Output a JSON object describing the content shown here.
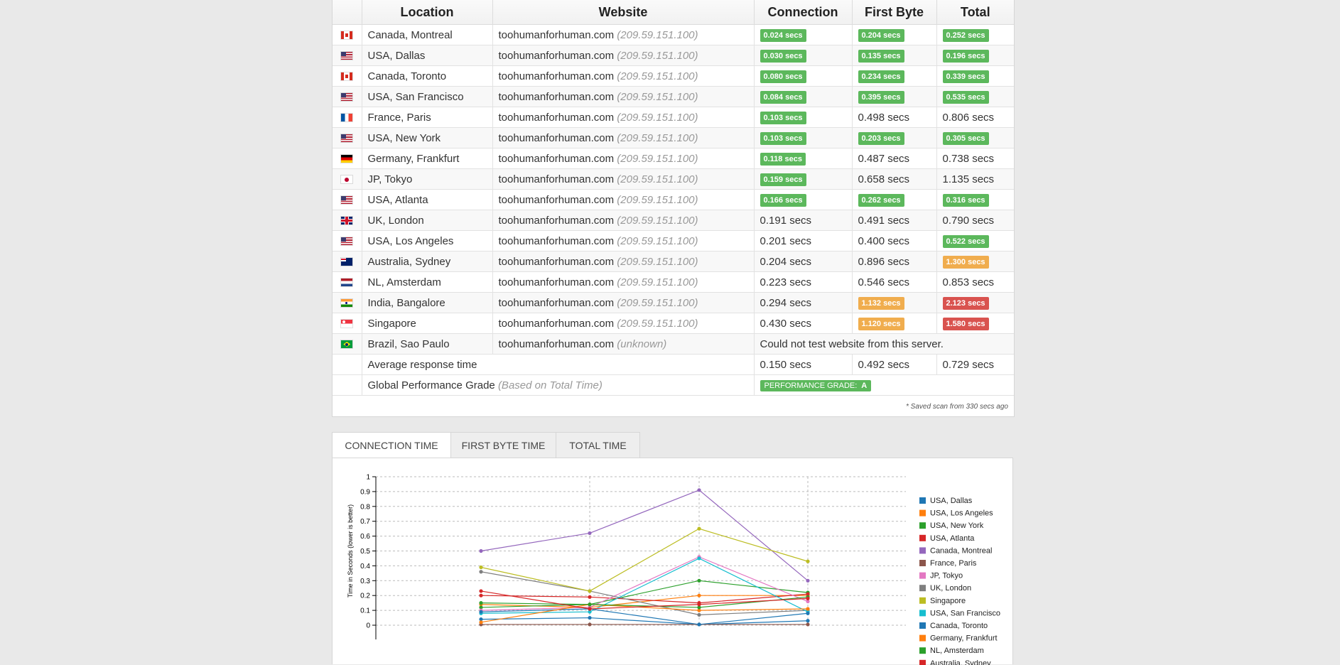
{
  "table": {
    "headers": {
      "location": "Location",
      "website": "Website",
      "connection": "Connection",
      "first_byte": "First Byte",
      "total": "Total"
    },
    "rows": [
      {
        "flag": "ca",
        "location": "Canada, Montreal",
        "site": "toohumanforhuman.com",
        "ip": "(209.59.151.100)",
        "conn": "0.024 secs",
        "conn_s": "green",
        "fb": "0.204 secs",
        "fb_s": "green",
        "total": "0.252 secs",
        "total_s": "green"
      },
      {
        "flag": "us",
        "location": "USA, Dallas",
        "site": "toohumanforhuman.com",
        "ip": "(209.59.151.100)",
        "conn": "0.030 secs",
        "conn_s": "green",
        "fb": "0.135 secs",
        "fb_s": "green",
        "total": "0.196 secs",
        "total_s": "green"
      },
      {
        "flag": "ca",
        "location": "Canada, Toronto",
        "site": "toohumanforhuman.com",
        "ip": "(209.59.151.100)",
        "conn": "0.080 secs",
        "conn_s": "green",
        "fb": "0.234 secs",
        "fb_s": "green",
        "total": "0.339 secs",
        "total_s": "green"
      },
      {
        "flag": "us",
        "location": "USA, San Francisco",
        "site": "toohumanforhuman.com",
        "ip": "(209.59.151.100)",
        "conn": "0.084 secs",
        "conn_s": "green",
        "fb": "0.395 secs",
        "fb_s": "green",
        "total": "0.535 secs",
        "total_s": "green"
      },
      {
        "flag": "fr",
        "location": "France, Paris",
        "site": "toohumanforhuman.com",
        "ip": "(209.59.151.100)",
        "conn": "0.103 secs",
        "conn_s": "green",
        "fb": "0.498 secs",
        "fb_s": "",
        "total": "0.806 secs",
        "total_s": ""
      },
      {
        "flag": "us",
        "location": "USA, New York",
        "site": "toohumanforhuman.com",
        "ip": "(209.59.151.100)",
        "conn": "0.103 secs",
        "conn_s": "green",
        "fb": "0.203 secs",
        "fb_s": "green",
        "total": "0.305 secs",
        "total_s": "green"
      },
      {
        "flag": "de",
        "location": "Germany, Frankfurt",
        "site": "toohumanforhuman.com",
        "ip": "(209.59.151.100)",
        "conn": "0.118 secs",
        "conn_s": "green",
        "fb": "0.487 secs",
        "fb_s": "",
        "total": "0.738 secs",
        "total_s": ""
      },
      {
        "flag": "jp",
        "location": "JP, Tokyo",
        "site": "toohumanforhuman.com",
        "ip": "(209.59.151.100)",
        "conn": "0.159 secs",
        "conn_s": "green",
        "fb": "0.658 secs",
        "fb_s": "",
        "total": "1.135 secs",
        "total_s": ""
      },
      {
        "flag": "us",
        "location": "USA, Atlanta",
        "site": "toohumanforhuman.com",
        "ip": "(209.59.151.100)",
        "conn": "0.166 secs",
        "conn_s": "green",
        "fb": "0.262 secs",
        "fb_s": "green",
        "total": "0.316 secs",
        "total_s": "green"
      },
      {
        "flag": "uk",
        "location": "UK, London",
        "site": "toohumanforhuman.com",
        "ip": "(209.59.151.100)",
        "conn": "0.191 secs",
        "conn_s": "",
        "fb": "0.491 secs",
        "fb_s": "",
        "total": "0.790 secs",
        "total_s": ""
      },
      {
        "flag": "us",
        "location": "USA, Los Angeles",
        "site": "toohumanforhuman.com",
        "ip": "(209.59.151.100)",
        "conn": "0.201 secs",
        "conn_s": "",
        "fb": "0.400 secs",
        "fb_s": "",
        "total": "0.522 secs",
        "total_s": "green"
      },
      {
        "flag": "au",
        "location": "Australia, Sydney",
        "site": "toohumanforhuman.com",
        "ip": "(209.59.151.100)",
        "conn": "0.204 secs",
        "conn_s": "",
        "fb": "0.896 secs",
        "fb_s": "",
        "total": "1.300 secs",
        "total_s": "orange"
      },
      {
        "flag": "nl",
        "location": "NL, Amsterdam",
        "site": "toohumanforhuman.com",
        "ip": "(209.59.151.100)",
        "conn": "0.223 secs",
        "conn_s": "",
        "fb": "0.546 secs",
        "fb_s": "",
        "total": "0.853 secs",
        "total_s": ""
      },
      {
        "flag": "in",
        "location": "India, Bangalore",
        "site": "toohumanforhuman.com",
        "ip": "(209.59.151.100)",
        "conn": "0.294 secs",
        "conn_s": "",
        "fb": "1.132 secs",
        "fb_s": "orange",
        "total": "2.123 secs",
        "total_s": "red"
      },
      {
        "flag": "sg",
        "location": "Singapore",
        "site": "toohumanforhuman.com",
        "ip": "(209.59.151.100)",
        "conn": "0.430 secs",
        "conn_s": "",
        "fb": "1.120 secs",
        "fb_s": "orange",
        "total": "1.580 secs",
        "total_s": "red"
      },
      {
        "flag": "br",
        "location": "Brazil, Sao Paulo",
        "site": "toohumanforhuman.com",
        "ip": "(unknown)",
        "error": "Could not test website from this server."
      }
    ],
    "average": {
      "label": "Average response time",
      "conn": "0.150 secs",
      "fb": "0.492 secs",
      "total": "0.729 secs"
    },
    "grade": {
      "label": "Global Performance Grade",
      "sub": "(Based on Total Time)",
      "badge": "PERFORMANCE GRADE:",
      "value": "A"
    },
    "saved_note": "* Saved scan from 330 secs ago",
    "status_colors": {
      "green": "#5cb85c",
      "orange": "#f0ad4e",
      "red": "#d9534f"
    }
  },
  "tabs": [
    {
      "label": "CONNECTION TIME",
      "active": true
    },
    {
      "label": "FIRST BYTE TIME",
      "active": false
    },
    {
      "label": "TOTAL TIME",
      "active": false
    }
  ],
  "chart_data": {
    "type": "line",
    "ylabel": "Time in Seconds (lower is better)",
    "ylim": [
      0,
      1
    ],
    "yticks": [
      "0",
      "0.1",
      "0.2",
      "0.3",
      "0.4",
      "0.5",
      "0.6",
      "0.7",
      "0.8",
      "0.9",
      "1"
    ],
    "x": [
      1,
      2,
      3,
      4
    ],
    "grid": true,
    "legend_position": "right",
    "series": [
      {
        "name": "USA, Dallas",
        "color": "#1f77b4",
        "values": [
          0.04,
          0.05,
          0.005,
          0.03
        ]
      },
      {
        "name": "USA, Los Angeles",
        "color": "#ff7f0e",
        "values": [
          0.14,
          0.12,
          0.2,
          0.2
        ]
      },
      {
        "name": "USA, New York",
        "color": "#2ca02c",
        "values": [
          0.12,
          0.14,
          0.3,
          0.22
        ]
      },
      {
        "name": "USA, Atlanta",
        "color": "#d62728",
        "values": [
          0.2,
          0.19,
          0.15,
          0.21
        ]
      },
      {
        "name": "Canada, Montreal",
        "color": "#9467bd",
        "values": [
          0.5,
          0.62,
          0.91,
          0.3
        ]
      },
      {
        "name": "France, Paris",
        "color": "#8c564b",
        "values": [
          0.005,
          0.005,
          0.005,
          0.005
        ]
      },
      {
        "name": "JP, Tokyo",
        "color": "#e377c2",
        "values": [
          0.1,
          0.12,
          0.46,
          0.16
        ]
      },
      {
        "name": "UK, London",
        "color": "#7f7f7f",
        "values": [
          0.36,
          0.23,
          0.07,
          0.1
        ]
      },
      {
        "name": "Singapore",
        "color": "#bcbd22",
        "values": [
          0.39,
          0.23,
          0.65,
          0.43
        ]
      },
      {
        "name": "USA, San Francisco",
        "color": "#17becf",
        "values": [
          0.08,
          0.09,
          0.45,
          0.09
        ]
      },
      {
        "name": "Canada, Toronto",
        "color": "#1f77b4",
        "values": [
          0.09,
          0.11,
          0.005,
          0.08
        ]
      },
      {
        "name": "Germany, Frankfurt",
        "color": "#ff7f0e",
        "values": [
          0.02,
          0.14,
          0.1,
          0.11
        ]
      },
      {
        "name": "NL, Amsterdam",
        "color": "#2ca02c",
        "values": [
          0.15,
          0.14,
          0.12,
          0.19
        ]
      },
      {
        "name": "Australia, Sydney",
        "color": "#d62728",
        "values": [
          0.23,
          0.11,
          0.14,
          0.18
        ]
      }
    ]
  }
}
